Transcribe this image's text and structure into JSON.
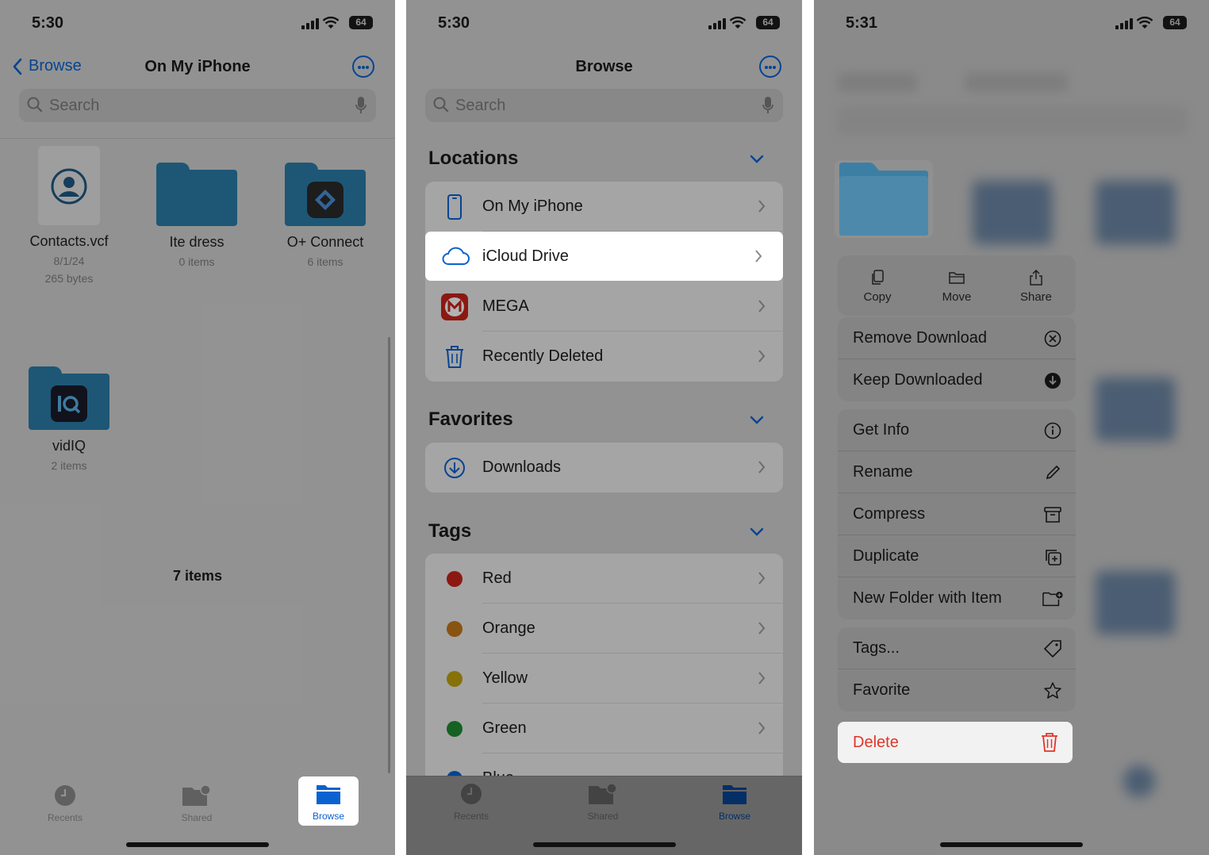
{
  "panel1": {
    "status": {
      "time": "5:30",
      "battery": "64"
    },
    "nav": {
      "back": "Browse",
      "title": "On My iPhone"
    },
    "search": {
      "placeholder": "Search"
    },
    "files": [
      {
        "name": "Contacts.vcf",
        "meta1": "8/1/24",
        "meta2": "265 bytes"
      },
      {
        "name": "Ite dress",
        "meta1": "0 items"
      },
      {
        "name": "O+ Connect",
        "meta1": "6 items"
      },
      {
        "name": "vidIQ",
        "meta1": "2 items"
      }
    ],
    "count": "7 items",
    "tabs": {
      "recents": "Recents",
      "shared": "Shared",
      "browse": "Browse"
    }
  },
  "panel2": {
    "status": {
      "time": "5:30",
      "battery": "64"
    },
    "nav": {
      "title": "Browse"
    },
    "search": {
      "placeholder": "Search"
    },
    "locations": {
      "heading": "Locations",
      "items": [
        "On My iPhone",
        "iCloud Drive",
        "MEGA",
        "Recently Deleted"
      ]
    },
    "favorites": {
      "heading": "Favorites",
      "items": [
        "Downloads"
      ]
    },
    "tags": {
      "heading": "Tags",
      "items": [
        {
          "label": "Red",
          "color": "#c9231b"
        },
        {
          "label": "Orange",
          "color": "#c4781a"
        },
        {
          "label": "Yellow",
          "color": "#c1a40e"
        },
        {
          "label": "Green",
          "color": "#1f8d31"
        },
        {
          "label": "Blue",
          "color": "#0a62d1"
        }
      ]
    },
    "tabs": {
      "recents": "Recents",
      "shared": "Shared",
      "browse": "Browse"
    }
  },
  "panel3": {
    "status": {
      "time": "5:31",
      "battery": "64"
    },
    "quick_actions": [
      "Copy",
      "Move",
      "Share"
    ],
    "menu": {
      "remove_download": "Remove Download",
      "keep_downloaded": "Keep Downloaded",
      "get_info": "Get Info",
      "rename": "Rename",
      "compress": "Compress",
      "duplicate": "Duplicate",
      "new_folder_with_item": "New Folder with Item",
      "tags": "Tags...",
      "favorite": "Favorite",
      "delete": "Delete"
    },
    "delete_color": "#e0352b"
  },
  "accent": "#0a62d1"
}
